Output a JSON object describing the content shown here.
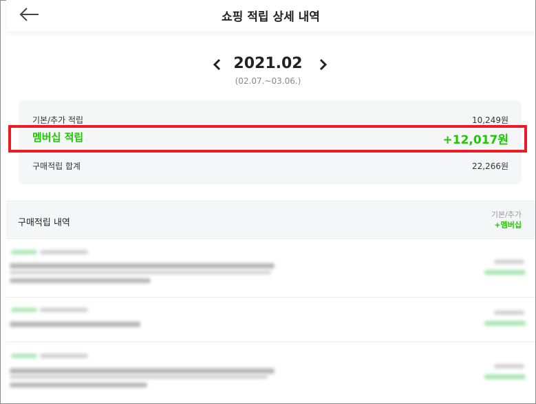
{
  "header": {
    "title": "쇼핑 적립 상세 내역",
    "back_icon": "arrow-left-icon"
  },
  "month_nav": {
    "month": "2021.02",
    "range": "(02.07.~03.06.)",
    "prev_icon": "chevron-left-icon",
    "next_icon": "chevron-right-icon"
  },
  "summary": {
    "basic_label": "기본/추가 적립",
    "basic_value": "10,249원",
    "membership_label": "멤버십 적립",
    "membership_value": "+12,017원",
    "total_label": "구매적립 합계",
    "total_value": "22,266원"
  },
  "history": {
    "title": "구매적립 내역",
    "col_basic": "기본/추가",
    "col_membership": "+멤버십"
  },
  "colors": {
    "accent_green": "#1ec800",
    "highlight_red": "#ed1c24"
  }
}
